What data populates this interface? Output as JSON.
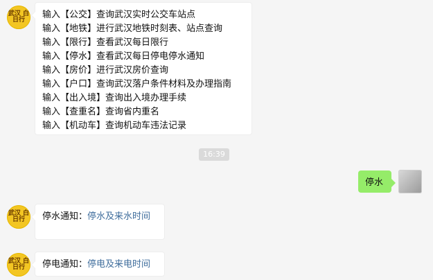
{
  "chat": {
    "bot_avatar_text": "武汉\n白日行",
    "bot_help_lines": [
      "输入【公交】查询武汉实时公交车站点",
      "输入【地铁】进行武汉地铁时刻表、站点查询",
      "输入【限行】查看武汉每日限行",
      "输入【停水】查看武汉每日停电停水通知",
      "输入【房价】进行武汉房价查询",
      "输入【户口】查询武汉落户条件材料及办理指南",
      "输入【出入境】查询出入境办理手续",
      "输入【查重名】查询省内重名",
      "输入【机动车】查询机动车违法记录"
    ],
    "timestamp": "16:39",
    "user_message": "停水",
    "bot_reply_1": {
      "prefix": "停水通知：",
      "link": "停水及来水时间"
    },
    "bot_reply_2": {
      "prefix": "停电通知：",
      "link": "停电及来电时间"
    }
  }
}
